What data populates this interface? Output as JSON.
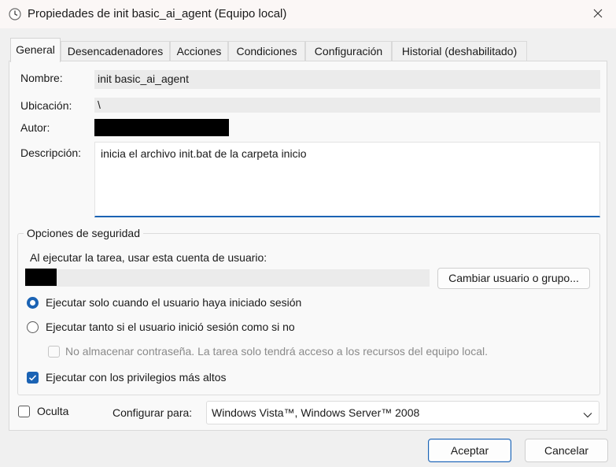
{
  "window": {
    "title": "Propiedades de init basic_ai_agent (Equipo local)",
    "icon": "clock-icon",
    "close_icon": "close-icon"
  },
  "tabs": [
    {
      "label": "General",
      "active": true
    },
    {
      "label": "Desencadenadores"
    },
    {
      "label": "Acciones"
    },
    {
      "label": "Condiciones"
    },
    {
      "label": "Configuración"
    },
    {
      "label": "Historial (deshabilitado)"
    }
  ],
  "general": {
    "name_label": "Nombre:",
    "name_value": "init basic_ai_agent",
    "location_label": "Ubicación:",
    "location_value": "\\",
    "author_label": "Autor:",
    "description_label": "Descripción:",
    "description_value": "inicia el archivo init.bat de la carpeta inicio"
  },
  "security": {
    "group_title": "Opciones de seguridad",
    "account_prompt": "Al ejecutar la tarea, usar esta cuenta de usuario:",
    "change_user_button": "Cambiar usuario o grupo...",
    "radio_logged_on": "Ejecutar solo cuando el usuario haya iniciado sesión",
    "radio_logged_on_selected": true,
    "radio_whether_or_not": "Ejecutar tanto si el usuario inició sesión como si no",
    "no_store_password": "No almacenar contraseña. La tarea solo tendrá acceso a los recursos del equipo local.",
    "highest_privileges": "Ejecutar con los privilegios más altos",
    "highest_privileges_checked": true
  },
  "footer": {
    "hidden_label": "Oculta",
    "hidden_checked": false,
    "configure_for_label": "Configurar para:",
    "configure_for_value": "Windows Vista™, Windows Server™ 2008",
    "ok_button": "Aceptar",
    "cancel_button": "Cancelar"
  },
  "colors": {
    "accent": "#1b63b4",
    "window_bg": "#f0f0f0",
    "panel_bg": "#f9f9f9"
  }
}
